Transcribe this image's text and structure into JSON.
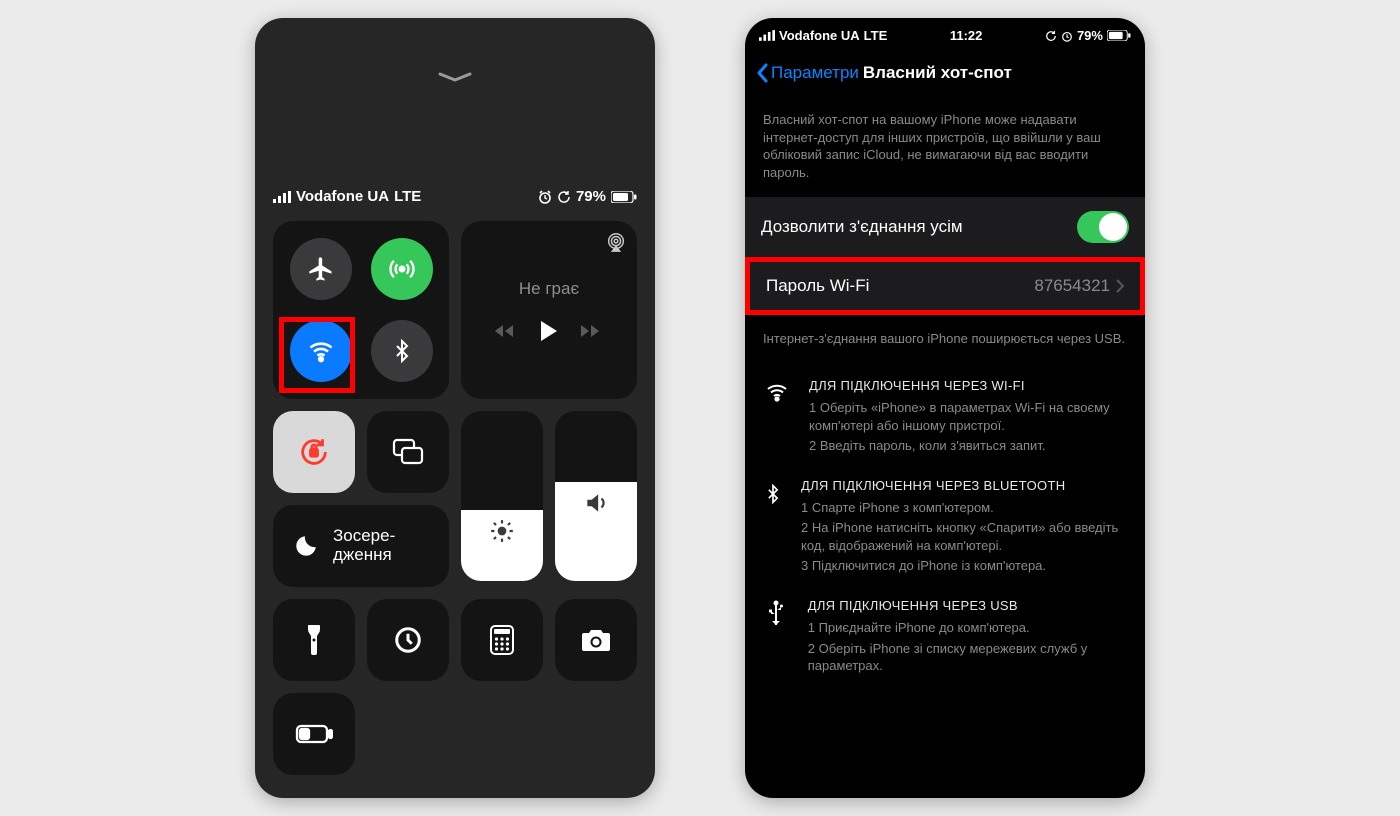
{
  "left": {
    "status": {
      "carrier": "Vodafone UA",
      "net": "LTE",
      "battery": "79%"
    },
    "media": {
      "title": "Не грає"
    },
    "focus": {
      "label": "Зосере-\nдження"
    },
    "brightnessPct": 42,
    "volumePct": 58
  },
  "right": {
    "status": {
      "carrier": "Vodafone UA",
      "net": "LTE",
      "time": "11:22",
      "battery": "79%"
    },
    "nav": {
      "back": "Параметри",
      "title": "Власний хот-спот"
    },
    "desc": "Власний хот-спот на вашому iPhone може надавати інтернет-доступ для інших пристроїв, що ввійшли у ваш обліковий запис iCloud, не вимагаючи від вас вводити пароль.",
    "allow": {
      "label": "Дозволити з'єднання усім"
    },
    "pwd": {
      "label": "Пароль Wi-Fi",
      "value": "87654321"
    },
    "note": "Інтернет-з'єднання вашого iPhone поширюється через USB.",
    "wifi": {
      "h": "ДЛЯ ПІДКЛЮЧЕННЯ ЧЕРЕЗ WI-FI",
      "l1": "1 Оберіть «iPhone» в параметрах Wi-Fi на своєму комп'ютері або іншому пристрої.",
      "l2": "2 Введіть пароль, коли з'явиться запит."
    },
    "bt": {
      "h": "ДЛЯ ПІДКЛЮЧЕННЯ ЧЕРЕЗ BLUETOOTH",
      "l1": "1 Спарте iPhone з комп'ютером.",
      "l2": "2 На iPhone натисніть кнопку «Спарити» або введіть код, відображений на комп'ютері.",
      "l3": "3 Підключитися до iPhone із комп'ютера."
    },
    "usb": {
      "h": "ДЛЯ ПІДКЛЮЧЕННЯ ЧЕРЕЗ USB",
      "l1": "1 Приєднайте iPhone до комп'ютера.",
      "l2": "2 Оберіть iPhone зі списку мережевих служб у параметрах."
    }
  }
}
